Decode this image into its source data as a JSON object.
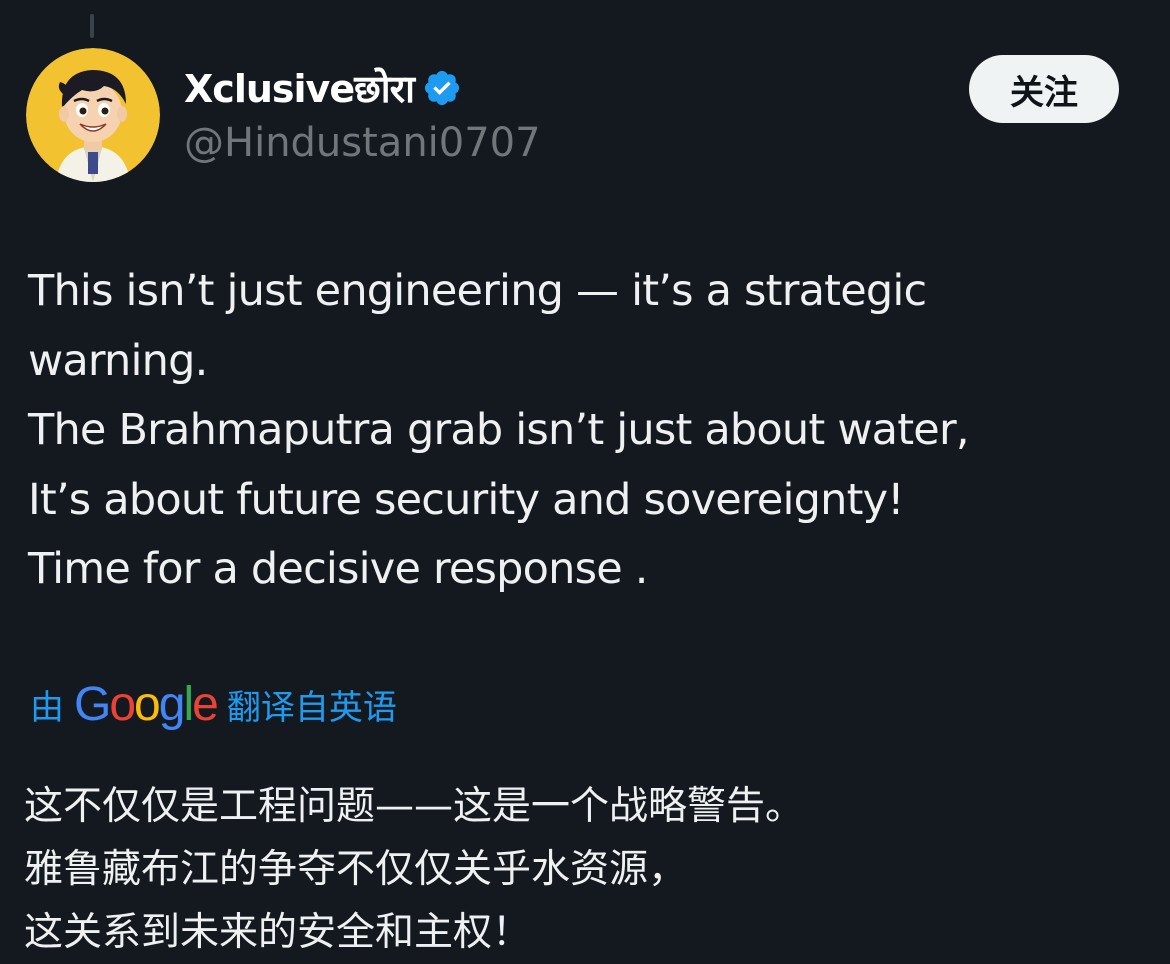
{
  "author": {
    "display_name": "Xclusiveछोरा",
    "handle": "@Hindustani0707",
    "verified": true,
    "avatar_icon": "cartoon-boy-avatar"
  },
  "follow_button": {
    "label": "关注"
  },
  "tweet": {
    "lines": [
      "This isn’t just engineering — it’s a strategic",
      "warning.",
      "The Brahmaputra grab isn’t just about water,",
      "It’s about future security and sovereignty!",
      "Time for a decisive response ."
    ]
  },
  "translation": {
    "prefix": "由",
    "google_letters": [
      "G",
      "o",
      "o",
      "g",
      "l",
      "e"
    ],
    "google_colors": [
      "#4285F4",
      "#EA4335",
      "#FBBC05",
      "#4285F4",
      "#34A853",
      "#EA4335"
    ],
    "suffix": "翻译自英语",
    "lines": [
      "这不仅仅是工程问题——这是一个战略警告。",
      "雅鲁藏布江的争夺不仅仅关乎水资源，",
      "这关系到未来的安全和主权！"
    ]
  },
  "colors": {
    "background": "#14191f",
    "link": "#1d9bf0",
    "verified_badge": "#1d9bf0",
    "muted": "#71767b"
  }
}
